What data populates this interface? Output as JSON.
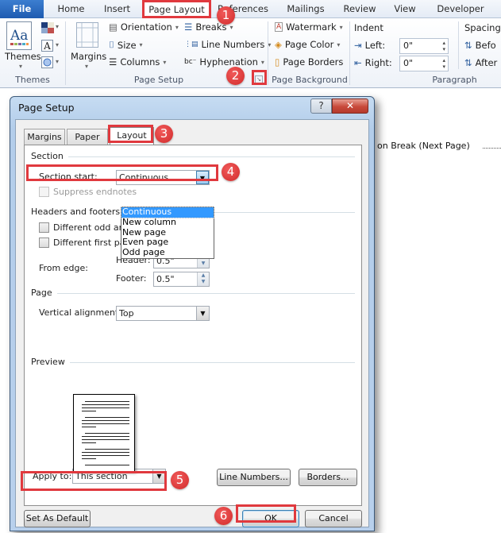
{
  "ribbon": {
    "tabs": [
      {
        "id": "file",
        "label": "File"
      },
      {
        "id": "home",
        "label": "Home"
      },
      {
        "id": "insert",
        "label": "Insert"
      },
      {
        "id": "page-layout",
        "label": "Page Layout",
        "active": true
      },
      {
        "id": "references",
        "label": "References"
      },
      {
        "id": "mailings",
        "label": "Mailings"
      },
      {
        "id": "review",
        "label": "Review"
      },
      {
        "id": "view",
        "label": "View"
      },
      {
        "id": "developer",
        "label": "Developer"
      }
    ],
    "groups": {
      "themes": {
        "label": "Themes",
        "themes_button": "Themes",
        "icons": [
          "theme-colors-icon",
          "theme-fonts-icon",
          "theme-effects-icon"
        ]
      },
      "page_setup": {
        "label": "Page Setup",
        "margins": "Margins",
        "orientation": "Orientation",
        "size": "Size",
        "columns": "Columns",
        "breaks": "Breaks",
        "line_numbers": "Line Numbers",
        "hyphenation": "Hyphenation",
        "launcher_icon": "dialog-launcher-icon"
      },
      "page_background": {
        "label": "Page Background",
        "watermark": "Watermark",
        "page_color": "Page Color",
        "page_borders": "Page Borders"
      },
      "paragraph": {
        "label": "Paragraph",
        "indent_header": "Indent",
        "left_label": "Left:",
        "left_value": "0\"",
        "right_label": "Right:",
        "right_value": "0\"",
        "spacing_header": "Spacing",
        "before_label": "Befo",
        "after_label": "After"
      }
    }
  },
  "document": {
    "visible_text": "on Break (Next Page)"
  },
  "dialog": {
    "title": "Page Setup",
    "help_label": "?",
    "close_label": "✕",
    "tabs": [
      {
        "label": "Margins"
      },
      {
        "label": "Paper"
      },
      {
        "label": "Layout",
        "active": true
      }
    ],
    "section": {
      "header": "Section",
      "section_start_label": "Section start:",
      "section_start_value": "Continuous",
      "options": [
        "Continuous",
        "New column",
        "New page",
        "Even page",
        "Odd page"
      ],
      "selected_option": "Continuous",
      "suppress_endnotes_label": "Suppress endnotes",
      "suppress_endnotes_checked": false
    },
    "headers_footers": {
      "header": "Headers and footers",
      "diff_odd_even_label": "Different odd and even",
      "diff_odd_even_checked": false,
      "diff_first_page_label": "Different first page",
      "diff_first_page_checked": false,
      "from_edge_label": "From edge:",
      "header_label": "Header:",
      "header_value": "0.5\"",
      "footer_label": "Footer:",
      "footer_value": "0.5\""
    },
    "page": {
      "header": "Page",
      "vertical_alignment_label": "Vertical alignment:",
      "vertical_alignment_value": "Top"
    },
    "preview": {
      "header": "Preview"
    },
    "apply_to_label": "Apply to:",
    "apply_to_value": "This section",
    "line_numbers_button": "Line Numbers...",
    "borders_button": "Borders...",
    "set_default_button": "Set As Default",
    "ok_button": "OK",
    "cancel_button": "Cancel"
  },
  "annotations": {
    "steps": [
      "1",
      "2",
      "3",
      "4",
      "5",
      "6"
    ],
    "color": "#e0393e"
  }
}
